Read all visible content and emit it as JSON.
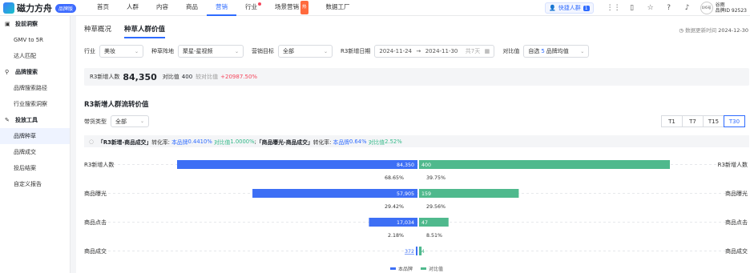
{
  "app": {
    "logo_text": "磁力方舟",
    "logo_badge": "品牌版"
  },
  "nav": {
    "items": [
      {
        "label": "首页",
        "dot": false,
        "hot": false
      },
      {
        "label": "人群",
        "dot": false,
        "hot": false
      },
      {
        "label": "内容",
        "dot": false,
        "hot": false
      },
      {
        "label": "商品",
        "dot": false,
        "hot": false
      },
      {
        "label": "营销",
        "dot": false,
        "hot": false
      },
      {
        "label": "行业",
        "dot": true,
        "hot": false
      },
      {
        "label": "场景营销",
        "dot": false,
        "hot": true
      },
      {
        "label": "数据工厂",
        "dot": false,
        "hot": false
      }
    ],
    "active_index": 4,
    "hot_badge": "热"
  },
  "header_right": {
    "quick_label": "快捷人群",
    "quick_count": "1",
    "account_name": "谷雨",
    "account_id": "品牌ID 92523",
    "avatar_text": "0/6号"
  },
  "sidebar": {
    "groups": [
      {
        "label": "投前洞察",
        "icon": "book-icon",
        "items": [
          "GMV to 5R",
          "达人匹配"
        ]
      },
      {
        "label": "品牌搜索",
        "icon": "search-icon",
        "items": [
          "品牌搜索路径",
          "行业搜索洞察"
        ]
      },
      {
        "label": "投放工具",
        "icon": "tool-icon",
        "items": [
          "品牌种草",
          "品牌成交",
          "投后结案",
          "自定义报告"
        ]
      }
    ],
    "active_item": "品牌种草"
  },
  "tabs": [
    "种草概况",
    "种草人群价值"
  ],
  "active_tab": 1,
  "update": {
    "label": "数据更新时间",
    "value": "2024-12-30"
  },
  "filters": {
    "industry_label": "行业",
    "industry_value": "美妆",
    "field_label": "种草阵地",
    "field_value": "聚星-星视频",
    "goal_label": "营销目标",
    "goal_value": "全部",
    "date_label": "R3新增日期",
    "date_start": "2024-11-24",
    "date_arrow": "→",
    "date_end": "2024-11-30",
    "date_days": "共7天",
    "compare_label": "对比值",
    "compare_prefix": "自选",
    "compare_num": "5",
    "compare_suffix": "品牌均值"
  },
  "stats": {
    "label": "R3新增人数",
    "value": "84,350",
    "cmp_label": "对比值",
    "cmp_value": "400",
    "ratio_label": "较对比值",
    "ratio_value": "+20987.50%"
  },
  "section": {
    "title": "R3新增人群流转价值",
    "goods_label": "带货类型",
    "goods_value": "全部"
  },
  "periods": [
    "T1",
    "T7",
    "T15",
    "T30"
  ],
  "active_period": "T30",
  "formula": {
    "part1_title": "「R3新增-商品成交」",
    "rate_label": "转化率:",
    "brand_label": "本品牌",
    "part1_brand": "0.4410%",
    "cmp_label": "对比值",
    "part1_cmp": "1.0000%",
    "separator": ";",
    "part2_title": "「商品曝光-商品成交」",
    "part2_brand": "0.64%",
    "part2_cmp": "2.52%"
  },
  "chart_data": {
    "type": "bar",
    "layout": "butterfly-funnel",
    "categories": [
      "R3新增人数",
      "商品曝光",
      "商品点击",
      "商品成交"
    ],
    "series": [
      {
        "name": "本品牌",
        "color": "#3d6ff5",
        "values": [
          84350,
          57905,
          17034,
          372
        ],
        "labels": [
          "84,350",
          "57,905",
          "17,034",
          "372"
        ]
      },
      {
        "name": "对比值",
        "color": "#4fb98d",
        "values": [
          400,
          159,
          47,
          4
        ],
        "labels": [
          "400",
          "159",
          "47",
          "4"
        ]
      }
    ],
    "conversion": [
      {
        "brand": "68.65%",
        "cmp": "39.75%"
      },
      {
        "brand": "29.42%",
        "cmp": "29.56%"
      },
      {
        "brand": "2.18%",
        "cmp": "8.51%"
      }
    ],
    "title": "",
    "xlabel": "",
    "ylabel": "",
    "legend_position": "bottom"
  }
}
